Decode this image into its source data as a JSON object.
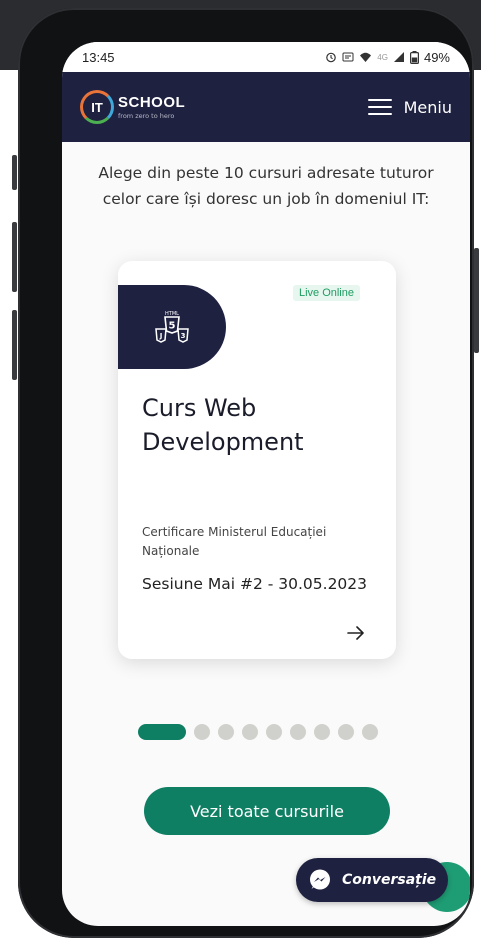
{
  "status_bar": {
    "time": "13:45",
    "icons": [
      "alarm-icon",
      "volte-icon",
      "wifi-icon",
      "4g-icon",
      "signal-icon",
      "battery-icon"
    ],
    "battery": "49%"
  },
  "navbar": {
    "logo_mark": "IT",
    "logo_name": "SCHOOL",
    "logo_tagline": "from zero to hero",
    "menu_label": "Meniu"
  },
  "intro": {
    "line1": "Alege din peste 10 cursuri adresate tuturor",
    "line2": "celor care își doresc un job în domeniul IT:"
  },
  "course_card": {
    "icon": "html-js-css-icon",
    "tag": "Live Online",
    "title_line1": "Curs Web",
    "title_line2": "Development",
    "certification": "Certificare Ministerul Educației Naționale",
    "session": "Sesiune Mai #2 - 30.05.2023"
  },
  "carousel": {
    "total": 9,
    "active_index": 0
  },
  "cta": {
    "label": "Vezi toate cursurile"
  },
  "chat": {
    "label": "Conversație"
  },
  "colors": {
    "navy": "#1e2140",
    "accent_green": "#0f7f63",
    "tag_green": "#1f9d62"
  }
}
